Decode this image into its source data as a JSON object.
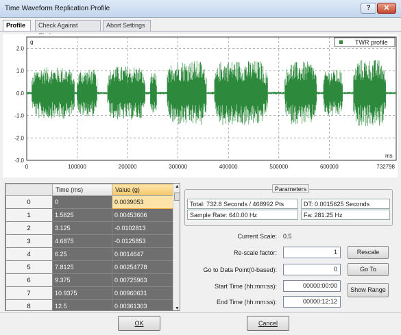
{
  "window": {
    "title": "Time Waveform Replication Profile",
    "help": "?",
    "close": "✕"
  },
  "tabs": [
    {
      "label": "Profile"
    },
    {
      "label": "Check Against Shaker"
    },
    {
      "label": "Abort Settings"
    }
  ],
  "chart": {
    "ylabel": "g",
    "xlabel": "ms",
    "legend": "TWR profile",
    "series_color": "#2d8a3c",
    "y_ticks": [
      "2.0",
      "1.0",
      "0.0",
      "-1.0",
      "-2.0",
      "-3.0"
    ],
    "x_ticks": [
      "0",
      "100000",
      "200000",
      "300000",
      "400000",
      "500000",
      "600000",
      "732798"
    ]
  },
  "chart_data": {
    "type": "line",
    "ylabel": "g",
    "xlabel": "ms",
    "series": [
      {
        "name": "TWR profile"
      }
    ],
    "xlim": [
      0,
      732798
    ],
    "ylim": [
      -3.0,
      2.5
    ],
    "grid": true,
    "legend_position": "top-right",
    "bursts": [
      {
        "x": [
          10000,
          95000
        ],
        "amp": 1.15
      },
      {
        "x": [
          100000,
          140000
        ],
        "amp": 1.05
      },
      {
        "x": [
          160000,
          235000
        ],
        "amp": 1.2
      },
      {
        "x": [
          245000,
          258000
        ],
        "amp": 0.9
      },
      {
        "x": [
          278000,
          357000
        ],
        "amp": 1.45
      },
      {
        "x": [
          372000,
          478000
        ],
        "amp": 1.45
      },
      {
        "x": [
          512000,
          575000
        ],
        "amp": 1.4
      },
      {
        "x": [
          588000,
          627000
        ],
        "amp": 1.05
      },
      {
        "x": [
          648000,
          712000
        ],
        "amp": 1.5
      }
    ]
  },
  "grid": {
    "headers": [
      "",
      "Time (ms)",
      "Value (g)"
    ],
    "rows": [
      {
        "idx": "0",
        "time": "0",
        "value": "0.0039053"
      },
      {
        "idx": "1",
        "time": "1.5625",
        "value": "0.00453606"
      },
      {
        "idx": "2",
        "time": "3.125",
        "value": "-0.0102813"
      },
      {
        "idx": "3",
        "time": "4.6875",
        "value": "-0.0125853"
      },
      {
        "idx": "4",
        "time": "6.25",
        "value": "0.0014647"
      },
      {
        "idx": "5",
        "time": "7.8125",
        "value": "0.00254778"
      },
      {
        "idx": "6",
        "time": "9.375",
        "value": "0.00725963"
      },
      {
        "idx": "7",
        "time": "10.9375",
        "value": "0.00960631"
      },
      {
        "idx": "8",
        "time": "12.5",
        "value": "0.00361303"
      }
    ]
  },
  "parameters": {
    "legend": "Parameters",
    "total": "Total: 732.8 Seconds / 468992 Pts",
    "dt": "DT: 0.0015625 Seconds",
    "sample_rate": "Sample Rate: 640.00 Hz",
    "fa": "Fa: 281.25 Hz"
  },
  "form": {
    "current_scale_label": "Current Scale:",
    "current_scale_value": "0.5",
    "rescale_label": "Re-scale factor:",
    "rescale_value": "1",
    "rescale_button": "Rescale",
    "goto_label": "Go to Data Point(0-based):",
    "goto_value": "0",
    "goto_button": "Go To",
    "start_label": "Start Time (hh:mm:ss):",
    "start_value": "00000:00:00",
    "end_label": "End Time (hh:mm:ss):",
    "end_value": "00000:12:12",
    "show_range_button": "Show Range"
  },
  "footer": {
    "ok": "OK",
    "cancel": "Cancel"
  }
}
